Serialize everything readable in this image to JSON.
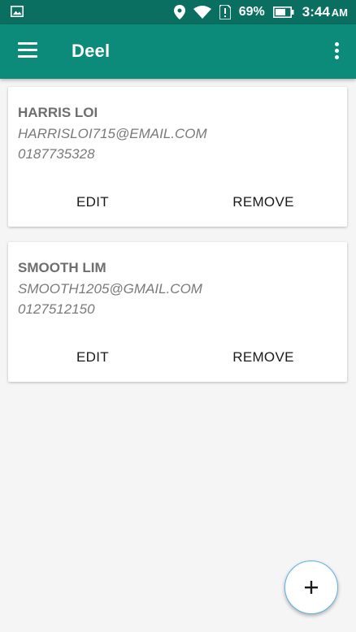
{
  "status_bar": {
    "battery_percent": "69%",
    "time": "3:44",
    "ampm": "AM",
    "icons": [
      "image-icon",
      "location-icon",
      "wifi-icon",
      "alert-icon",
      "battery-icon"
    ]
  },
  "app_bar": {
    "title": "Deel",
    "left_icon": "hamburger-menu-icon",
    "right_icon": "more-vert-icon",
    "color": "#0c8a7a"
  },
  "contacts": [
    {
      "name": "HARRIS LOI",
      "email": "HARRISLOI715@EMAIL.COM",
      "phone": "0187735328",
      "edit_label": "EDIT",
      "remove_label": "REMOVE"
    },
    {
      "name": "SMOOTH LIM",
      "email": "SMOOTH1205@GMAIL.COM",
      "phone": "0127512150",
      "edit_label": "EDIT",
      "remove_label": "REMOVE"
    }
  ],
  "fab": {
    "icon": "plus-icon",
    "border_color": "#5bb4e8"
  }
}
